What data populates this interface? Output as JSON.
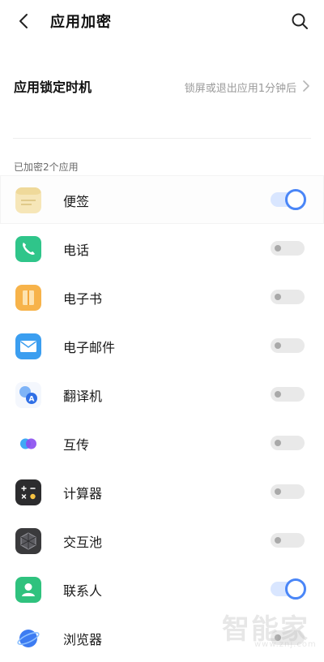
{
  "header": {
    "title": "应用加密",
    "back_icon": "chevron-left-icon",
    "search_icon": "search-icon"
  },
  "lock_timing": {
    "label": "应用锁定时机",
    "value": "锁屏或退出应用1分钟后"
  },
  "section": {
    "label": "已加密2个应用"
  },
  "apps": [
    {
      "name": "便签",
      "icon": "notes-icon",
      "icon_color": "#f6e6b8",
      "enabled": true
    },
    {
      "name": "电话",
      "icon": "phone-icon",
      "icon_color": "#2fc58a",
      "enabled": false
    },
    {
      "name": "电子书",
      "icon": "ebook-icon",
      "icon_color": "#f7b34a",
      "enabled": false
    },
    {
      "name": "电子邮件",
      "icon": "email-icon",
      "icon_color": "#3b9ef0",
      "enabled": false
    },
    {
      "name": "翻译机",
      "icon": "translator-icon",
      "icon_color": "#4a8ef2",
      "enabled": false
    },
    {
      "name": "互传",
      "icon": "share-icon",
      "icon_color": "#6a5cf2",
      "enabled": false
    },
    {
      "name": "计算器",
      "icon": "calculator-icon",
      "icon_color": "#2c2c2e",
      "enabled": false
    },
    {
      "name": "交互池",
      "icon": "interaction-pool-icon",
      "icon_color": "#3a3a3c",
      "enabled": false
    },
    {
      "name": "联系人",
      "icon": "contacts-icon",
      "icon_color": "#2fc27e",
      "enabled": true
    },
    {
      "name": "浏览器",
      "icon": "browser-icon",
      "icon_color": "#3d7cf2",
      "enabled": false
    }
  ],
  "watermark": {
    "text": "智能家",
    "url": "www.znj.com"
  },
  "colors": {
    "toggle_on": "#4a86f7",
    "toggle_off": "#e9e9e9"
  }
}
